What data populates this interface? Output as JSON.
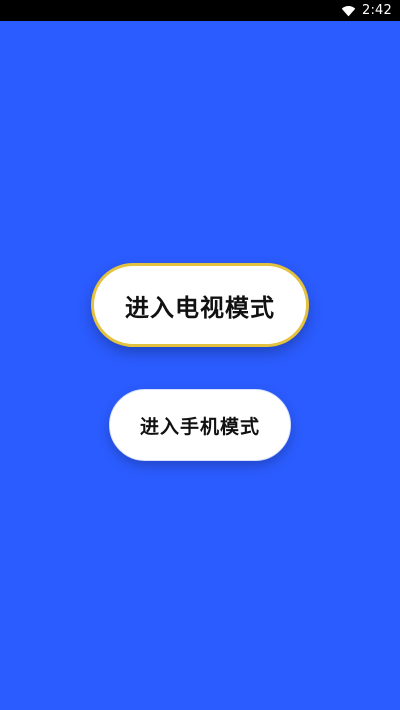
{
  "status_bar": {
    "time": "2:42",
    "wifi_icon": "wifi-icon"
  },
  "buttons": {
    "tv_mode": "进入电视模式",
    "phone_mode": "进入手机模式"
  },
  "colors": {
    "background": "#2b5cff",
    "tv_border": "#e3c23f",
    "button_fill": "#ffffff",
    "text": "#111111"
  }
}
